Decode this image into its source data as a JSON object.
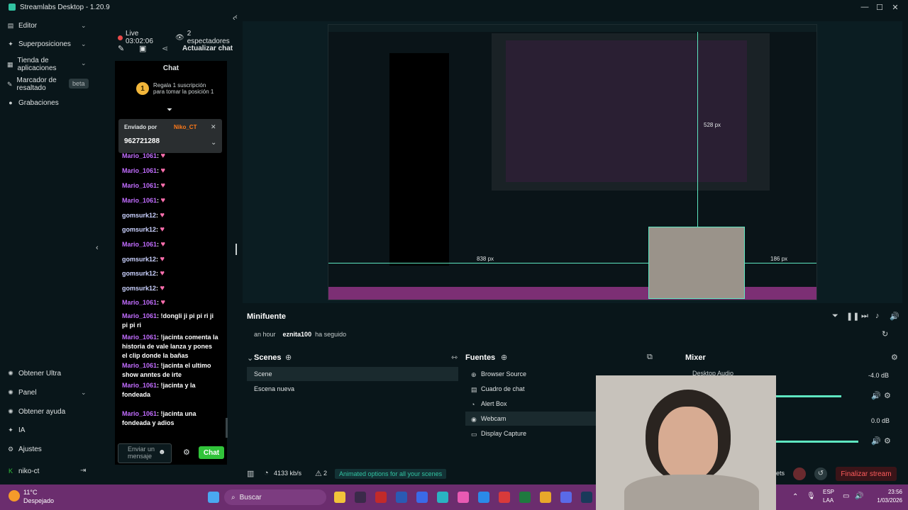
{
  "window": {
    "title": "Streamlabs Desktop - 1.20.9"
  },
  "sidebar": {
    "top_items": [
      {
        "label": "Editor"
      },
      {
        "label": "Superposiciones"
      },
      {
        "label": "Tienda de aplicaciones"
      },
      {
        "label": "Marcador de resaltado"
      },
      {
        "label": "Grabaciones"
      }
    ],
    "beta_badge": "beta",
    "bottom_items": [
      {
        "label": "Obtener Ultra"
      },
      {
        "label": "Panel"
      },
      {
        "label": "Obtener ayuda"
      },
      {
        "label": "IA"
      },
      {
        "label": "Ajustes"
      },
      {
        "label": "niko-ct"
      }
    ]
  },
  "stream_status": {
    "live_label": "Live 03:02:06",
    "viewers": "2 espectadores"
  },
  "chat": {
    "refresh_label": "Actualizar chat",
    "title": "Chat",
    "gift": {
      "count": "1",
      "text": "Regala 1 suscripción para tomar la posición 1"
    },
    "pinned": {
      "sent_by": "Enviado por",
      "user": "Niko_CT",
      "amount": "962721288"
    },
    "messages": [
      {
        "user": "Mario_1061",
        "text": "",
        "heart": true
      },
      {
        "user": "Mario_1061",
        "text": "",
        "heart": true
      },
      {
        "user": "Mario_1061",
        "text": "",
        "heart": true
      },
      {
        "user": "Mario_1061",
        "text": "",
        "heart": true
      },
      {
        "user": "gomsurk12",
        "text": "",
        "heart": true
      },
      {
        "user": "gomsurk12",
        "text": "",
        "heart": true
      },
      {
        "user": "Mario_1061",
        "text": "",
        "heart": true
      },
      {
        "user": "gomsurk12",
        "text": "",
        "heart": true
      },
      {
        "user": "gomsurk12",
        "text": "",
        "heart": true
      },
      {
        "user": "gomsurk12",
        "text": "",
        "heart": true
      },
      {
        "user": "Mario_1061",
        "text": "",
        "heart": true
      },
      {
        "user": "Mario_1061",
        "text": "!dongli ji pi pi ri ji pi pi ri",
        "heart": false
      },
      {
        "user": "Mario_1061",
        "text": "!jacinta comenta la historia de vale lanza y pones el clip donde la bañas",
        "heart": false
      },
      {
        "user": "Mario_1061",
        "text": "!jacinta el ultimo show anntes de irte",
        "heart": false
      },
      {
        "user": "Mario_1061",
        "text": "!jacinta y la fondeada",
        "heart": false
      },
      {
        "user": "Mario_1061",
        "text": "!jacinta una fondeada y adios",
        "heart": false
      }
    ],
    "input_placeholder": "Enviar un mensaje",
    "send_label": "Chat"
  },
  "preview": {
    "guide_1": "838 px",
    "guide_2": "186 px",
    "guide_3": "528 px"
  },
  "minifuente": {
    "title": "Minifuente",
    "time": "an hour",
    "user": "eznita100",
    "action": "ha seguido"
  },
  "scenes": {
    "title": "Scenes",
    "items": [
      {
        "label": "Scene"
      },
      {
        "label": "Escena nueva"
      }
    ]
  },
  "sources": {
    "title": "Fuentes",
    "items": [
      {
        "label": "Browser Source"
      },
      {
        "label": "Cuadro de chat"
      },
      {
        "label": "Alert Box"
      },
      {
        "label": "Webcam"
      },
      {
        "label": "Display Capture"
      }
    ]
  },
  "mixer": {
    "title": "Mixer",
    "channels": [
      {
        "label": "Desktop Audio",
        "db": "-4.0 dB"
      },
      {
        "label": "",
        "db": "0.0 dB"
      }
    ]
  },
  "statusbar": {
    "bitrate": "4133 kb/s",
    "warnings": "2",
    "hint": "Animated options for all your scenes",
    "partial": "ets",
    "end_stream": "Finalizar stream"
  },
  "taskbar": {
    "weather_temp": "11°C",
    "weather_desc": "Despejado",
    "search": "Buscar",
    "lang_1": "ESP",
    "lang_2": "LAA",
    "time": "23:56",
    "date": "1/03/2026"
  },
  "colors": {
    "accent": "#31c3a2",
    "live": "#e84a4a",
    "chat_user": "#c26dff",
    "chat_send": "#31c33a",
    "taskbar": "#6b2d6e"
  }
}
